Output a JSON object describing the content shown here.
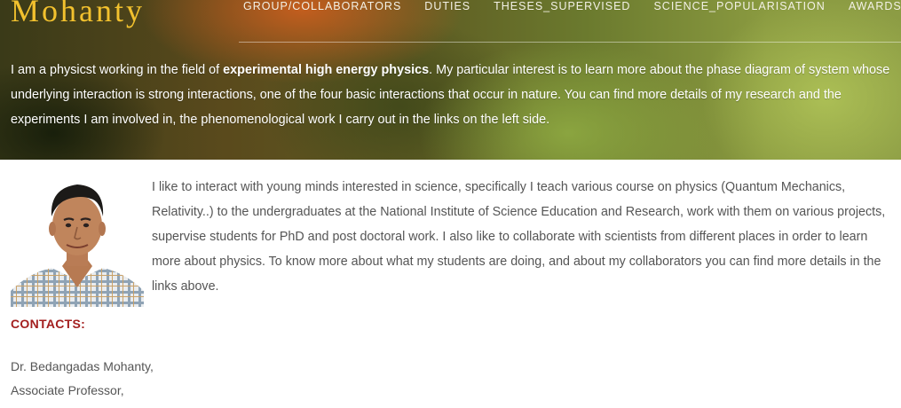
{
  "site": {
    "brand": "Mohanty"
  },
  "nav": {
    "items": [
      {
        "label": "GROUP/COLLABORATORS"
      },
      {
        "label": "DUTIES"
      },
      {
        "label": "THESES_SUPERVISED"
      },
      {
        "label": "SCIENCE_POPULARISATION"
      },
      {
        "label": "AWARDS"
      }
    ]
  },
  "intro": {
    "text_before": "I am a physicst working in the field of ",
    "highlight": "experimental high energy physics",
    "text_after": ". My particular interest is to learn more about the phase diagram of system whose underlying interaction is strong interactions, one of the four basic interactions that occur in nature. You can find more details of my research and the experiments I am involved in, the phenomenological work I carry out in the links on the left side."
  },
  "bio": {
    "text": "I like to interact with young minds interested in science, specifically I teach various course on physics (Quantum Mechanics, Relativity..) to the undergraduates at the National Institute of Science Education and Research, work with them on various projects, supervise students for PhD and post doctoral work. I also like to collaborate with scientists from different places in order to learn more about physics. To know more about what my students are doing, and about my collaborators you can find more details in the links above."
  },
  "contacts": {
    "heading": "CONTACTS:",
    "name": "Dr. Bedangadas Mohanty,",
    "title": "Associate Professor,"
  },
  "colors": {
    "brand": "#f2c12e",
    "contacts_heading": "#a31f1f"
  }
}
